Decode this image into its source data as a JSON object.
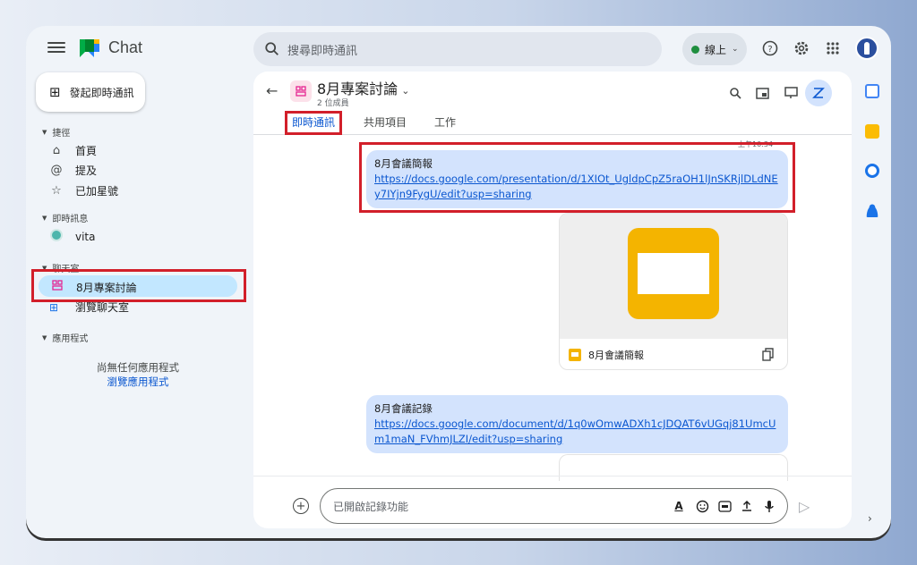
{
  "app": {
    "title": "Chat"
  },
  "search": {
    "placeholder": "搜尋即時通訊"
  },
  "status": {
    "label": "線上"
  },
  "sidebar": {
    "new_chat_label": "發起即時通訊",
    "shortcuts_header": "捷徑",
    "shortcuts": [
      {
        "icon": "home-icon",
        "label": "首頁"
      },
      {
        "icon": "mention-icon",
        "label": "提及"
      },
      {
        "icon": "star-icon",
        "label": "已加星號"
      }
    ],
    "dm_header": "即時訊息",
    "dms": [
      {
        "label": "vita"
      }
    ],
    "rooms_header": "聊天室",
    "rooms": [
      {
        "label": "8月專案討論",
        "active": true
      }
    ],
    "browse_rooms_label": "瀏覽聊天室",
    "apps_header": "應用程式",
    "no_apps_text": "尚無任何應用程式",
    "browse_apps_label": "瀏覽應用程式"
  },
  "room": {
    "title": "8月專案討論",
    "members": "2 位成員",
    "tabs": [
      {
        "label": "即時通訊",
        "active": true
      },
      {
        "label": "共用項目",
        "active": false
      },
      {
        "label": "工作",
        "active": false
      }
    ]
  },
  "messages": {
    "timestamp": "上午10:34",
    "msg1": {
      "title": "8月會議簡報",
      "link": "https://docs.google.com/presentation/d/1XIOt_UgldpCpZ5raOH1lJnSKRjlDLdNEy7IYjn9FygU/edit?usp=sharing"
    },
    "attachment": {
      "name": "8月會議簡報"
    },
    "msg2": {
      "title": "8月會議記錄",
      "link": "https://docs.google.com/document/d/1q0wOmwADXh1cJDQAT6vUGqj81UmcUm1maN_FVhmJLZI/edit?usp=sharing"
    }
  },
  "compose": {
    "placeholder": "已開啟記錄功能"
  },
  "colors": {
    "accent": "#0b57d0",
    "highlight": "#d21f2a",
    "bubble": "#d3e3fd"
  }
}
